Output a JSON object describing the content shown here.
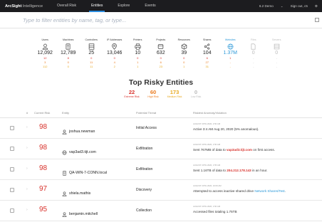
{
  "nav": {
    "brand": "ArcSight",
    "brand_suffix": " Intelligence",
    "items": [
      "Overall Risk",
      "Entities",
      "Explore",
      "Events"
    ],
    "active": "Entities",
    "version": "6.2 Demo",
    "signout": "Sign out, c5"
  },
  "search": {
    "placeholder": "Type to filter entities by name, tag, or type..."
  },
  "stats": [
    {
      "label": "Users",
      "icon": "user-icon",
      "total": "12,092",
      "red": "12",
      "orange": "3",
      "yellow": "112"
    },
    {
      "label": "Machines",
      "icon": "machine-icon",
      "total": "12,789",
      "red": "8",
      "orange": "0",
      "yellow": "0"
    },
    {
      "label": "Controllers",
      "icon": "controller-icon",
      "total": "25",
      "red": "0",
      "orange": "11",
      "yellow": "11"
    },
    {
      "label": "IP Addresses",
      "icon": "location-pin-icon",
      "total": "13,046",
      "red": "0",
      "orange": "4",
      "yellow": "2"
    },
    {
      "label": "Printers",
      "icon": "printer-icon",
      "total": "10",
      "red": "0",
      "orange": "1",
      "yellow": "1"
    },
    {
      "label": "Projects",
      "icon": "project-icon",
      "total": "632",
      "red": "0",
      "orange": "6",
      "yellow": "23"
    },
    {
      "label": "Resources",
      "icon": "cube-icon",
      "total": "39",
      "red": "0",
      "orange": "0",
      "yellow": "1"
    },
    {
      "label": "Shares",
      "icon": "share-icon",
      "total": "104",
      "red": "6",
      "orange": "27",
      "yellow": "31"
    },
    {
      "label": "Websites",
      "icon": "globe-icon",
      "total": "1.37M",
      "red": "1",
      "orange": "-",
      "yellow": "-"
    },
    {
      "label": "Files",
      "icon": "file-icon",
      "total": "0",
      "red": "-",
      "orange": "-",
      "yellow": "-"
    },
    {
      "label": "Servers",
      "icon": "server-icon",
      "total": "0",
      "red": "-",
      "orange": "-",
      "yellow": "-"
    }
  ],
  "top_risky": {
    "title": "Top Risky Entities",
    "counts": [
      {
        "value": "22",
        "label": "Extreme Risk",
        "color": "#d8322c"
      },
      {
        "value": "60",
        "label": "High Risk",
        "color": "#ea7a1e"
      },
      {
        "value": "173",
        "label": "Medium Risk",
        "color": "#e8a91f"
      },
      {
        "value": "0",
        "label": "Low Risk",
        "color": "#bbbbbb"
      }
    ]
  },
  "table": {
    "headers": {
      "num": "#",
      "score": "Current Risk",
      "entity": "Entity",
      "threat": "Potential Threat",
      "anomaly": "Riskiest Anomaly/Violation"
    },
    "rows": [
      {
        "score": "98",
        "icon": "user-icon",
        "entity": "joshua.newman",
        "threat": "Initial Access",
        "date": "AUGUST 20TH 2020, 2:50 AM",
        "text_pre": "Active 3:4 AM Aug 20, 2020 (5% anomalous).",
        "highlight": "",
        "text_post": ""
      },
      {
        "score": "98",
        "icon": "globe-icon",
        "entity": "vap3ad3.tijt.com",
        "threat": "Exfiltration",
        "date": "AUGUST 20TH 2020, 1:50 AM",
        "text_pre": "Sent 767MB of data to ",
        "highlight": "vap3ad3.tijt.com",
        "text_post": " on first access."
      },
      {
        "score": "98",
        "icon": "machine-icon",
        "entity": "QA-WIN-7-CONN.local",
        "threat": "Exfiltration",
        "date": "AUGUST 20TH 2020, 1:55 AM",
        "text_pre": "Sent 1.16TB of data to ",
        "highlight": "204.212.178.143",
        "text_post": " in an hour."
      },
      {
        "score": "97",
        "icon": "user-icon",
        "entity": "shiela.mathis",
        "threat": "Discovery",
        "date": "AUGUST 20TH 2020, 10:06 AM",
        "text_pre": "Attempted to access inactive shared drive ",
        "link": "Network Shares/Test",
        "text_post": "."
      },
      {
        "score": "95",
        "icon": "user-icon",
        "entity": "benjamin.mitchell",
        "threat": "Collection",
        "date": "AUGUST 20TH 2020, 1:50 AM",
        "text_pre": "Accessed files totaling 1.75TB",
        "highlight": "",
        "text_post": ""
      }
    ]
  }
}
